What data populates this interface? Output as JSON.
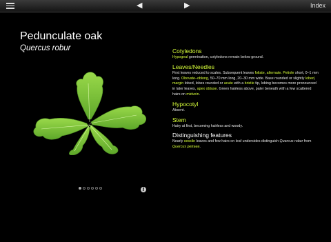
{
  "toolbar": {
    "index_label": "Index",
    "prev_glyph": "◀",
    "next_glyph": "▶"
  },
  "species": {
    "common_name": "Pedunculate oak",
    "latin_name": "Quercus robur"
  },
  "pager": {
    "pages": 6,
    "current": 1
  },
  "sections": {
    "cotyledons": {
      "heading": "Cotyledons",
      "term_hypogeal": "Hypogeal",
      "text": "germination, cotyledons remain below ground."
    },
    "leaves": {
      "heading": "Leaves/Needles",
      "t1": "First leaves reduced to scales. Subsequent leaves",
      "term_foliate": "foliate",
      "term_alternate": "alternate.",
      "term_petiole": "Petiole",
      "t2": "short, 0–1 mm long.",
      "term_obovate": "Obovate–oblong",
      "t3": ", 50–70 mm long, 20–30 mm wide. Base rounded or slightly",
      "term_lobed": "lobed",
      "t4": ",",
      "term_margin": "margin",
      "t5": "lobed, lobes rounded or",
      "term_acute": "acute",
      "t6": "with a",
      "term_bristle": "bristle",
      "t7": "tip, lobing becomes more pronounced in later leaves,",
      "term_apex": "apex obtuse",
      "t8": ". Green hairless above, paler beneath with a few scattered hairs on",
      "term_midvein": "midvein",
      "t9": "."
    },
    "hypocotyl": {
      "heading": "Hypocotyl",
      "text": "Absent."
    },
    "stem": {
      "heading": "Stem",
      "text": "Hairy at first, becoming hairless and woody."
    },
    "distinguishing": {
      "heading": "Distinguishing features",
      "t1": "Nearly",
      "term_sessile": "sessile",
      "t2": "leaves and few hairs on leaf undersides distinguish",
      "latin_robur": "Quercus robur",
      "t3": "from",
      "latin_petraea": "Quercus petraea",
      "t4": "."
    }
  },
  "colors": {
    "accent": "#d8ff3a",
    "leaf_green": "#7fc73a",
    "background": "#000000"
  }
}
